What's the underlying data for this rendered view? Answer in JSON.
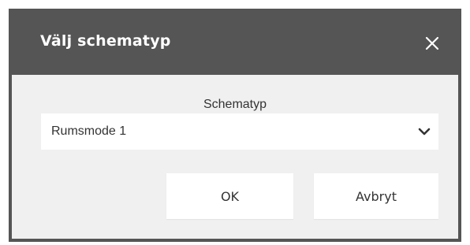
{
  "dialog": {
    "title": "Välj schematyp",
    "close_icon": "close-icon"
  },
  "form": {
    "field_label": "Schematyp",
    "selected_value": "Rumsmode 1",
    "dropdown_icon": "chevron-down-icon"
  },
  "buttons": {
    "ok_label": "OK",
    "cancel_label": "Avbryt"
  },
  "colors": {
    "header_bg": "#555555",
    "body_bg": "#f0f0f0",
    "title_text": "#ffffff",
    "body_text": "#333333"
  }
}
